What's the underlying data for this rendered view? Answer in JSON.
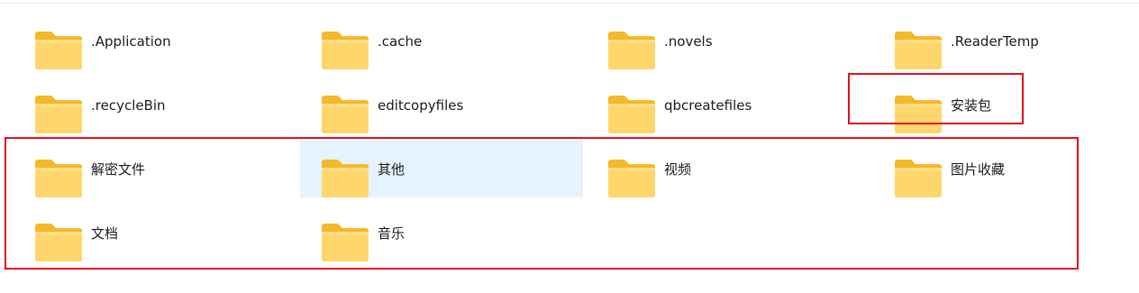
{
  "folders": [
    {
      "name": ".Application"
    },
    {
      "name": ".cache"
    },
    {
      "name": ".novels"
    },
    {
      "name": ".ReaderTemp"
    },
    {
      "name": ".recycleBin"
    },
    {
      "name": "editcopyfiles"
    },
    {
      "name": "qbcreatefiles"
    },
    {
      "name": "安装包"
    },
    {
      "name": "解密文件"
    },
    {
      "name": "其他",
      "selected": true
    },
    {
      "name": "视频"
    },
    {
      "name": "图片收藏"
    },
    {
      "name": "文档"
    },
    {
      "name": "音乐"
    }
  ],
  "colors": {
    "folder_back": "#f5b82a",
    "folder_front": "#ffd66b",
    "selection": "#e5f3ff",
    "annotation": "#e1121b"
  }
}
